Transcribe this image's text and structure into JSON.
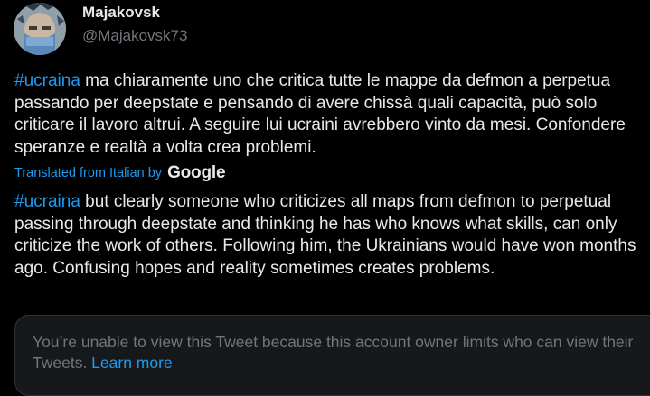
{
  "author": {
    "display_name": "Majakovsk",
    "handle": "@Majakovsk73"
  },
  "tweet": {
    "original": {
      "hashtag": "#ucraina",
      "text": " ma chiaramente uno che critica tutte le mappe da defmon a perpetua passando per deepstate e pensando di avere chissà quali capacità, può solo criticare il lavoro altrui. A seguire lui ucraini avrebbero vinto da mesi. Confondere speranze e realtà a volta crea problemi."
    },
    "translation": {
      "label": "Translated from Italian by",
      "provider": "Google",
      "hashtag": "#ucraina",
      "text": " but clearly someone who criticizes all maps from defmon to perpetual passing through deepstate and thinking he has who knows what skills, can only criticize the work of others. Following him, the Ukrainians would have won months ago. Confusing hopes and reality sometimes creates problems."
    }
  },
  "notice": {
    "text": "You’re unable to view this Tweet because this account owner limits who can view their Tweets. ",
    "link_label": "Learn more"
  },
  "colors": {
    "background": "#000000",
    "text_primary": "#e7e9ea",
    "text_secondary": "#71767b",
    "accent": "#1d9bf0",
    "notice_background": "#16181c"
  },
  "icons": {
    "avatar": "avatar-photo",
    "google": "google-logo"
  }
}
